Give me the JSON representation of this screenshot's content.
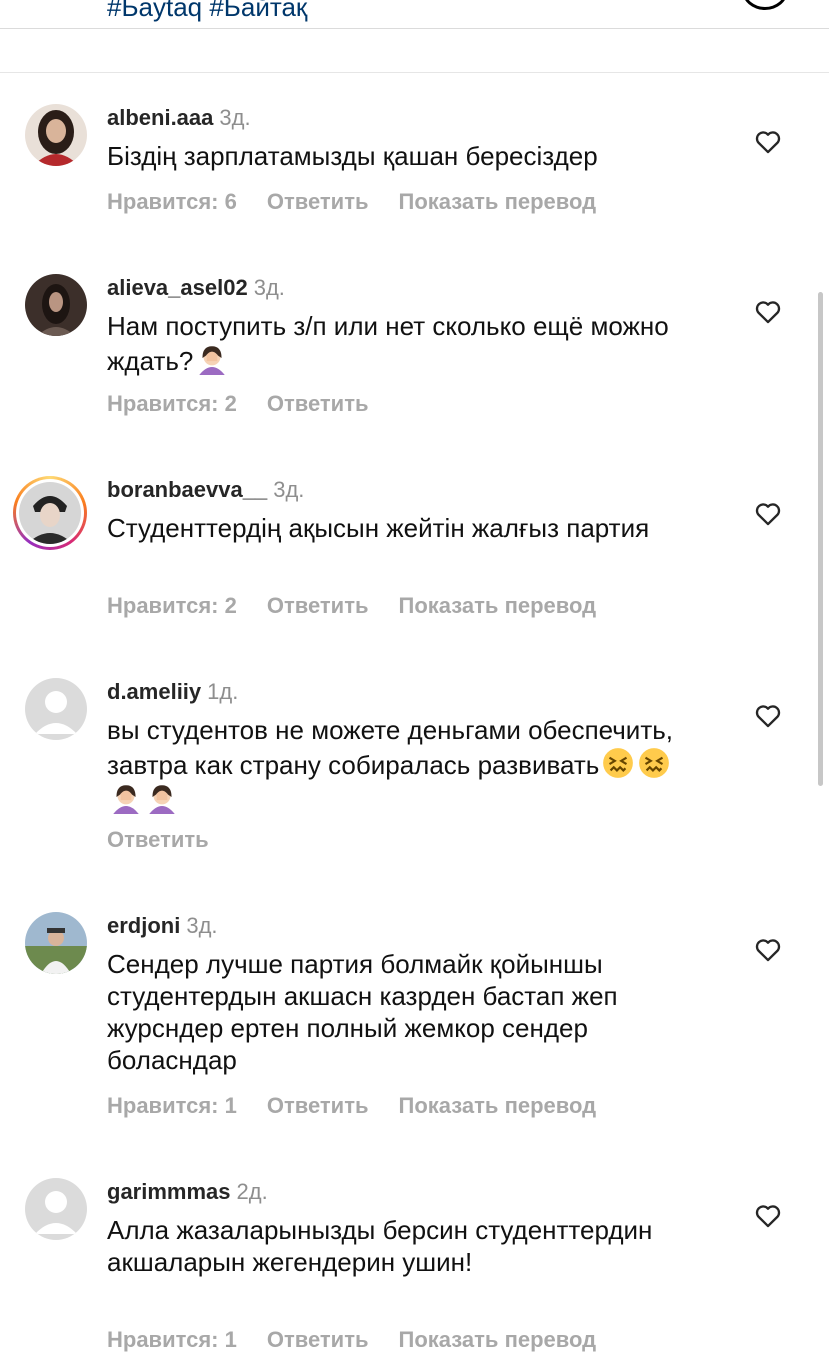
{
  "header": {
    "hashtags": "#Бaytaq #Байтақ"
  },
  "comments": [
    {
      "username": "albeni.aaa",
      "time": "3д.",
      "text": "Біздің зарплатамызды қашан бересіздер",
      "emojis": [],
      "likes": "Нравится: 6",
      "reply": "Ответить",
      "translate": "Показать перевод",
      "avatar_color": "#b5292c"
    },
    {
      "username": "alieva_asel02",
      "time": "3д.",
      "text": "Нам поступить з/п или нет сколько ещё можно ждать?",
      "emojis": [
        "facepalm-woman"
      ],
      "likes": "Нравится: 2",
      "reply": "Ответить",
      "translate": "",
      "avatar_color": "#3c2f2a"
    },
    {
      "username": "boranbaevva__",
      "time": "3д.",
      "text": "Студенттердің ақысын жейтін жалғыз партия",
      "emojis": [],
      "likes": "Нравится: 2",
      "reply": "Ответить",
      "translate": "Показать перевод",
      "avatar_color": "#2a2a2a"
    },
    {
      "username": "d.ameliiy",
      "time": "1д.",
      "text": "вы студентов не можете деньгами обеспечить, завтра как страну собиралась развивать",
      "emojis": [
        "confounded-face",
        "confounded-face",
        "facepalm-woman",
        "facepalm-woman"
      ],
      "likes": "",
      "reply": "Ответить",
      "translate": "",
      "avatar_color": "#dbdbdb"
    },
    {
      "username": "erdjoni",
      "time": "3д.",
      "text": "Сендер лучше партия болмайк қойыншы студентердын акшасн казрден бастап жеп журсндер ертен полный жемкор сендер боласндар",
      "emojis": [],
      "likes": "Нравится: 1",
      "reply": "Ответить",
      "translate": "Показать перевод",
      "avatar_color": "#6e8fb0"
    },
    {
      "username": "garimmmas",
      "time": "2д.",
      "text": "Алла жазаларынызды берсин студенттердин акшаларын жегендерин ушин!",
      "emojis": [],
      "likes": "Нравится: 1",
      "reply": "Ответить",
      "translate": "Показать перевод",
      "avatar_color": "#dbdbdb"
    }
  ]
}
